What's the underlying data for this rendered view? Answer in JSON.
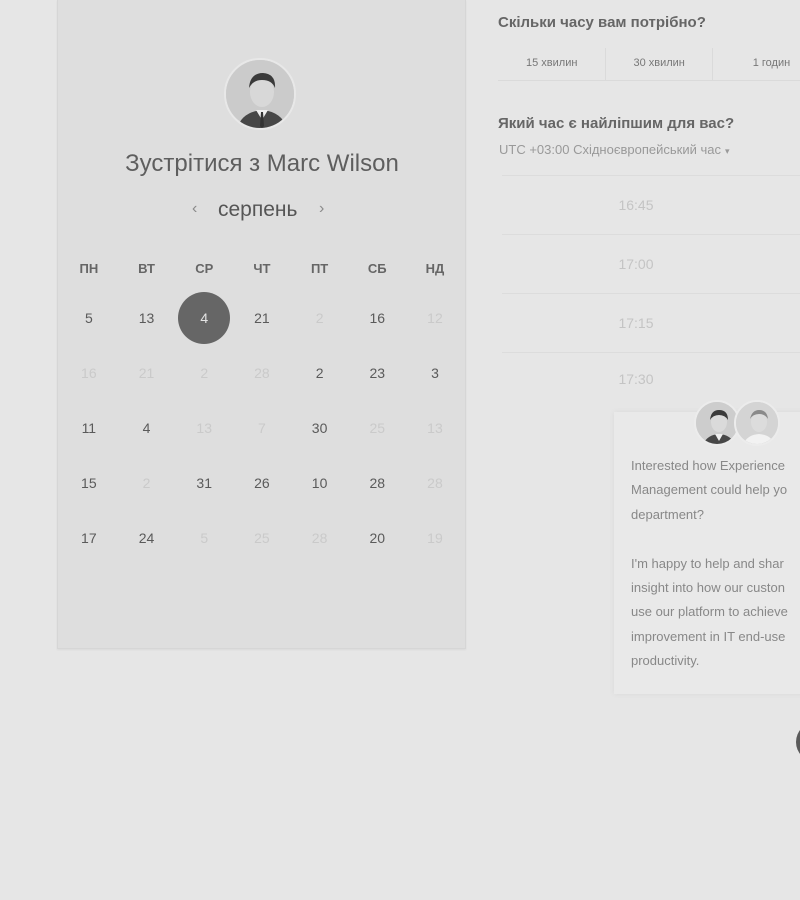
{
  "calendar": {
    "title": "Зустрітися з Marc Wilson",
    "month": "серпень",
    "prev_icon": "chevron-left-icon",
    "next_icon": "chevron-right-icon",
    "weekdays": [
      "ПН",
      "ВТ",
      "СР",
      "ЧТ",
      "ПТ",
      "СБ",
      "НД"
    ],
    "weeks": [
      [
        {
          "d": "5",
          "dim": false
        },
        {
          "d": "13",
          "dim": false
        },
        {
          "d": "4",
          "dim": false,
          "sel": true
        },
        {
          "d": "21",
          "dim": false
        },
        {
          "d": "2",
          "dim": true
        },
        {
          "d": "16",
          "dim": false
        },
        {
          "d": "12",
          "dim": true
        }
      ],
      [
        {
          "d": "16",
          "dim": true
        },
        {
          "d": "21",
          "dim": true
        },
        {
          "d": "2",
          "dim": true
        },
        {
          "d": "28",
          "dim": true
        },
        {
          "d": "2",
          "dim": false
        },
        {
          "d": "23",
          "dim": false
        },
        {
          "d": "3",
          "dim": false
        }
      ],
      [
        {
          "d": "11",
          "dim": false
        },
        {
          "d": "4",
          "dim": false
        },
        {
          "d": "13",
          "dim": true
        },
        {
          "d": "7",
          "dim": true
        },
        {
          "d": "30",
          "dim": false
        },
        {
          "d": "25",
          "dim": true
        },
        {
          "d": "13",
          "dim": true
        }
      ],
      [
        {
          "d": "15",
          "dim": false
        },
        {
          "d": "2",
          "dim": true
        },
        {
          "d": "31",
          "dim": false
        },
        {
          "d": "26",
          "dim": false
        },
        {
          "d": "10",
          "dim": false
        },
        {
          "d": "28",
          "dim": false
        },
        {
          "d": "28",
          "dim": true
        }
      ],
      [
        {
          "d": "17",
          "dim": false
        },
        {
          "d": "24",
          "dim": false
        },
        {
          "d": "5",
          "dim": true
        },
        {
          "d": "25",
          "dim": true
        },
        {
          "d": "28",
          "dim": true
        },
        {
          "d": "20",
          "dim": false
        },
        {
          "d": "19",
          "dim": true
        }
      ]
    ],
    "selected_color": "#666666"
  },
  "duration": {
    "question": "Скільки часу вам потрібно?",
    "options": [
      "15 хвилин",
      "30 хвилин",
      "1 годин"
    ]
  },
  "time": {
    "question": "Який час є найліпшим для вас?",
    "timezone": "UTC +03:00 Східноєвропейський час",
    "timezone_caret": "▾",
    "slots": [
      "16:45",
      "17:00",
      "17:15",
      "17:30"
    ]
  },
  "chat": {
    "message": "Interested how Experience\nManagement could help yo\ndepartment?\n\nI'm happy to help and shar\ninsight into how our custon\nuse our platform to achieve\nimprovement in IT end-use\nproductivity."
  }
}
